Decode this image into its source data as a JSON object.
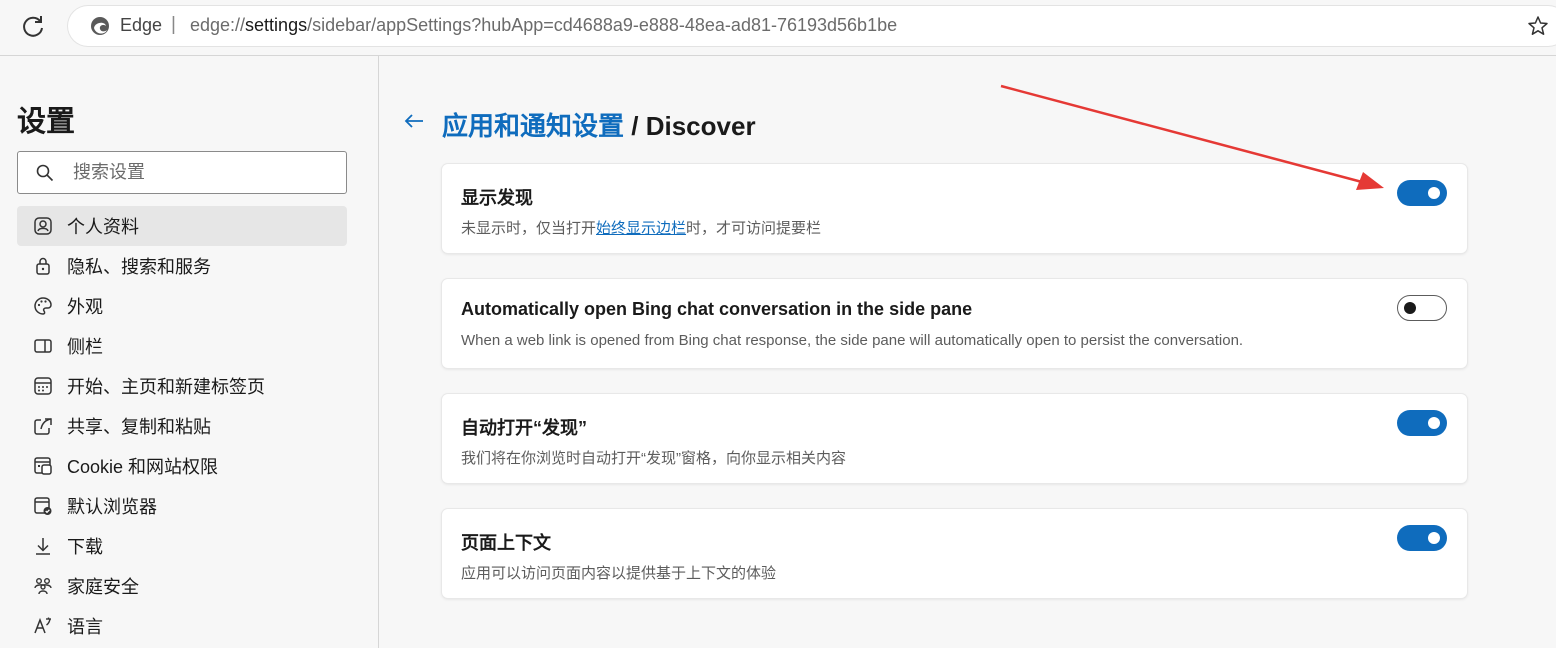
{
  "browser": {
    "edge_label": "Edge",
    "separator": "|",
    "url_prefix": "edge://",
    "url_host": "settings",
    "url_rest": "/sidebar/appSettings?hubApp=cd4688a9-e888-48ea-ad81-76193d56b1be"
  },
  "sidebar": {
    "title": "设置",
    "search_placeholder": "搜索设置",
    "items": [
      {
        "label": "个人资料",
        "icon": "profile-icon",
        "active": true
      },
      {
        "label": "隐私、搜索和服务",
        "icon": "lock-icon"
      },
      {
        "label": "外观",
        "icon": "palette-icon"
      },
      {
        "label": "侧栏",
        "icon": "sidebar-icon"
      },
      {
        "label": "开始、主页和新建标签页",
        "icon": "home-grid-icon"
      },
      {
        "label": "共享、复制和粘贴",
        "icon": "share-icon"
      },
      {
        "label": "Cookie 和网站权限",
        "icon": "cookie-site-icon"
      },
      {
        "label": "默认浏览器",
        "icon": "default-browser-icon"
      },
      {
        "label": "下载",
        "icon": "download-icon"
      },
      {
        "label": "家庭安全",
        "icon": "family-icon"
      },
      {
        "label": "语言",
        "icon": "language-icon"
      }
    ]
  },
  "main": {
    "breadcrumb_parent": "应用和通知设置",
    "breadcrumb_separator": "/",
    "breadcrumb_current": "Discover",
    "cards": [
      {
        "title": "显示发现",
        "desc_before": "未显示时，仅当打开",
        "desc_link": "始终显示边栏",
        "desc_after": "时，才可访问提要栏",
        "toggle": "on"
      },
      {
        "title": "Automatically open Bing chat conversation in the side pane",
        "desc": "When a web link is opened from Bing chat response, the side pane will automatically open to persist the conversation.",
        "toggle": "off"
      },
      {
        "title": "自动打开“发现”",
        "desc": "我们将在你浏览时自动打开“发现”窗格，向你显示相关内容",
        "toggle": "on"
      },
      {
        "title": "页面上下文",
        "desc": "应用可以访问页面内容以提供基于上下文的体验",
        "toggle": "on"
      }
    ]
  },
  "colors": {
    "accent": "#0f6cbd",
    "annotation_arrow": "#e53935"
  }
}
